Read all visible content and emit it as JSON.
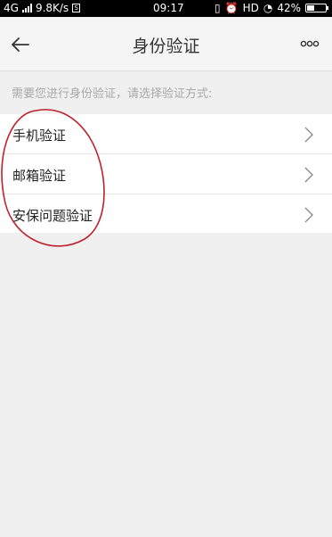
{
  "status_bar": {
    "network": "4G",
    "speed": "9.8K/s",
    "time": "09:17",
    "hd_label": "HD",
    "battery": "42%",
    "battery_level": 0.42
  },
  "header": {
    "title": "身份验证"
  },
  "prompt": "需要您进行身份验证，请选择验证方式:",
  "options": [
    {
      "label": "手机验证"
    },
    {
      "label": "邮箱验证"
    },
    {
      "label": "安保问题验证"
    }
  ],
  "colors": {
    "annotation": "#c0202a",
    "page_bg": "#f0f0f0"
  }
}
